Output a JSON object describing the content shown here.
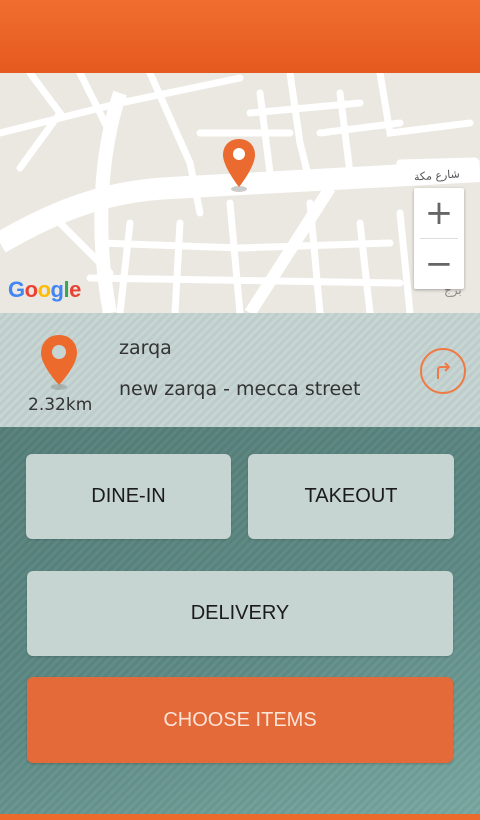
{
  "map": {
    "street_label_main": "شارع مكة",
    "street_label_corner": "برج",
    "logo": "Google",
    "zoom_in": "+",
    "zoom_out": "−"
  },
  "location": {
    "city": "zarqa",
    "street": "new zarqa - mecca street",
    "distance": "2.32km"
  },
  "options": {
    "dine_in": "DINE-IN",
    "takeout": "TAKEOUT",
    "delivery": "DELIVERY"
  },
  "action": {
    "choose_items": "CHOOSE ITEMS"
  },
  "colors": {
    "accent": "#e9652c",
    "button_bg": "#c6d4d2",
    "panel_bg": "#5f8b86"
  }
}
